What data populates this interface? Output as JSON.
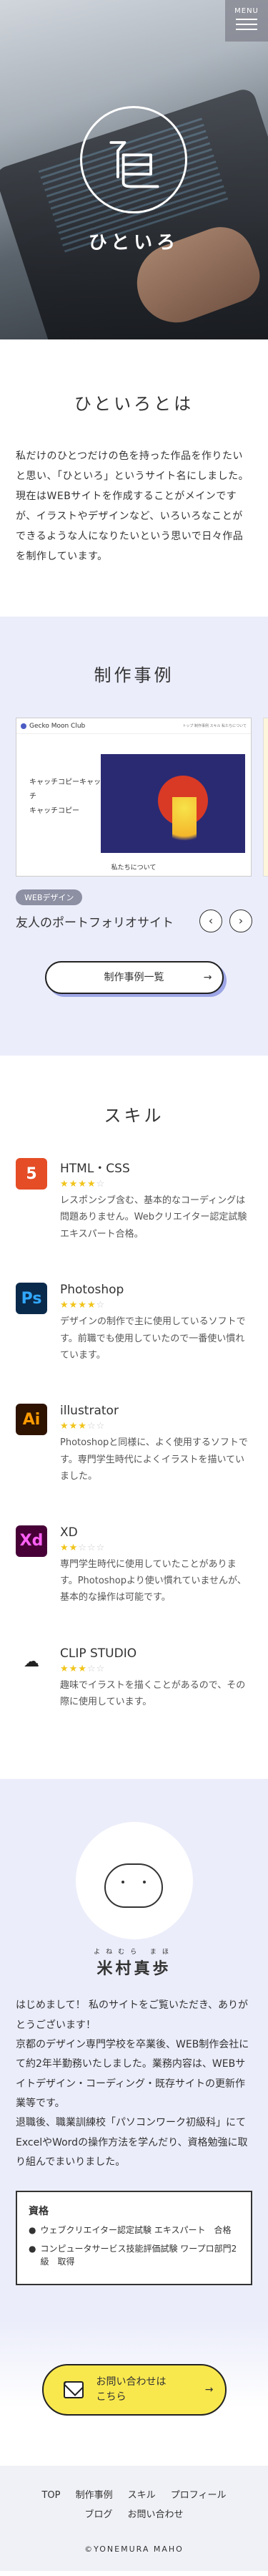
{
  "header": {
    "menu_label": "MENU",
    "site_name": "ひといろ"
  },
  "about": {
    "heading": "ひといろとは",
    "paragraphs": [
      "私だけのひとつだけの色を持った作品を作りたいと思い、「ひといろ」というサイト名にしました。",
      "現在はWEBサイトを作成することがメインですが、イラストやデザインなど、いろいろなことができるような人になりたいという思いで日々作品を制作しています。"
    ]
  },
  "works": {
    "heading": "制作事例",
    "site_preview": {
      "brand": "Gecko Moon Club",
      "nav": "トップ 制作事例 スキル 私たちについて",
      "catch1": "キャッチコピーキャッチ",
      "catch2": "キャッチコピー",
      "footer": "私たちについて"
    },
    "tag": "WEBデザイン",
    "title": "友人のポートフォリオサイト",
    "prev": "‹",
    "next": "›",
    "list_button": "制作事例一覧",
    "arrow": "→"
  },
  "skill": {
    "heading": "スキル",
    "items": [
      {
        "icon": "html5-css3-icon",
        "glyph": "5",
        "color": "#e44d26",
        "name": "HTML・CSS",
        "stars": "★★★★",
        "stars_off": "☆",
        "desc": "レスポンシブ含む、基本的なコーディングは問題ありません。Webクリエイター認定試験エキスパート合格。"
      },
      {
        "icon": "photoshop-icon",
        "glyph": "Ps",
        "color": "#0a2a4b",
        "name": "Photoshop",
        "stars": "★★★★",
        "stars_off": "☆",
        "desc": "デザインの制作で主に使用しているソフトです。前職でも使用していたので一番使い慣れています。"
      },
      {
        "icon": "illustrator-icon",
        "glyph": "Ai",
        "color": "#2e1300",
        "name": "illustrator",
        "stars": "★★★",
        "stars_off": "☆☆",
        "desc": "Photoshopと同様に、よく使用するソフトです。専門学生時代によくイラストを描いていました。"
      },
      {
        "icon": "xd-icon",
        "glyph": "Xd",
        "color": "#470137",
        "name": "XD",
        "stars": "★★",
        "stars_off": "☆☆☆",
        "desc": "専門学生時代に使用していたことがあります。Photoshopより使い慣れていませんが、基本的な操作は可能です。"
      },
      {
        "icon": "clip-studio-icon",
        "glyph": "☁",
        "color": "#ffffff",
        "name": "CLIP STUDIO",
        "stars": "★★★",
        "stars_off": "☆☆",
        "desc": "趣味でイラストを描くことがあるので、その際に使用しています。"
      }
    ]
  },
  "profile": {
    "ruby": "よねむら まほ",
    "name": "米村真歩",
    "paragraphs": [
      "はじめまして！ 私のサイトをご覧いただき、ありがとうございます！",
      "京都のデザイン専門学校を卒業後、WEB制作会社にて約2年半勤務いたしました。業務内容は、WEBサイトデザイン・コーディング・既存サイトの更新作業等です。",
      "退職後、職業訓練校「パソコンワーク初級科」にてExcelやWordの操作方法を学んだり、資格勉強に取り組んでまいりました。"
    ],
    "quals_heading": "資格",
    "quals": [
      "ウェブクリエイター認定試験 エキスパート　合格",
      "コンピュータサービス技能評価試験 ワープロ部門2級　取得"
    ]
  },
  "contact": {
    "line1": "お問い合わせは",
    "line2": "こちら",
    "arrow": "→"
  },
  "footer": {
    "nav": [
      "TOP",
      "制作事例",
      "スキル",
      "プロフィール",
      "ブログ",
      "お問い合わせ"
    ],
    "copyright": "©YONEMURA MAHO"
  }
}
